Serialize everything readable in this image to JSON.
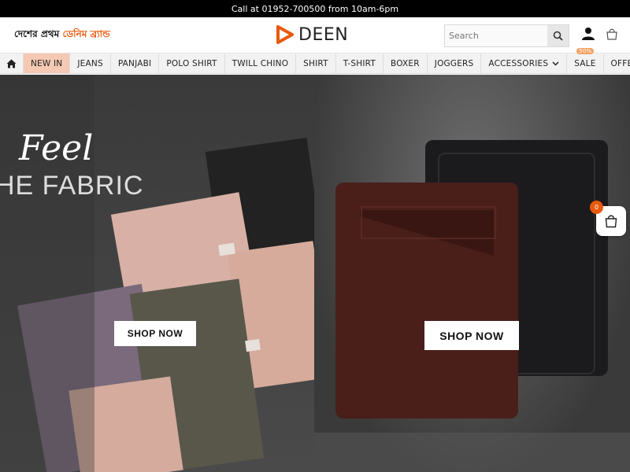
{
  "topbar": {
    "text": "Call at 01952-700500 from 10am-6pm"
  },
  "header": {
    "tagline_main": "দেশের প্রথম ",
    "tagline_accent": "ডেনিম ব্র্যান্ড",
    "logo_text": "DEEN",
    "search_placeholder": "Search"
  },
  "nav": {
    "items": [
      {
        "label": "NEW IN"
      },
      {
        "label": "JEANS"
      },
      {
        "label": "PANJABI"
      },
      {
        "label": "POLO SHIRT"
      },
      {
        "label": "TWILL CHINO"
      },
      {
        "label": "SHIRT"
      },
      {
        "label": "T-SHIRT"
      },
      {
        "label": "BOXER"
      },
      {
        "label": "JOGGERS"
      },
      {
        "label": "ACCESSORIES"
      },
      {
        "label": "SALE",
        "badge": "50%"
      },
      {
        "label": "OFFERS"
      }
    ]
  },
  "hero": {
    "left": {
      "script_text": "Feel",
      "headline": "HE FABRIC",
      "cta": "SHOP NOW"
    },
    "right": {
      "cta": "SHOP NOW"
    }
  },
  "cart": {
    "count": "0"
  },
  "colors": {
    "accent": "#e8590c",
    "active_nav": "#f5c9b3",
    "topbar": "#000000"
  }
}
